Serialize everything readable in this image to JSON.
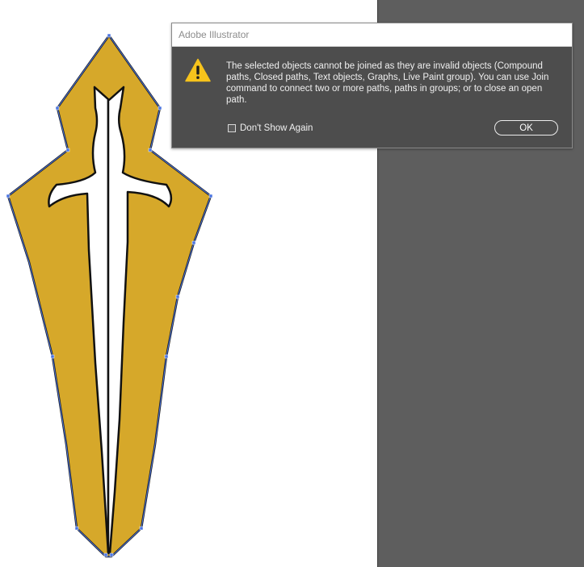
{
  "app": {
    "name": "Adobe Illustrator"
  },
  "colors": {
    "artwork_fill": "#d6a82a",
    "artwork_stroke": "#1a1a1a",
    "selection": "#4a74e0",
    "dialog_background": "#4d4d4d",
    "gutter": "#5e5e5e",
    "warning": "#f6c31c"
  },
  "dialog": {
    "title": "Adobe Illustrator",
    "icon": "warning-triangle-icon",
    "message": "The selected objects cannot be joined as they are invalid objects (Compound paths, Closed paths, Text objects, Graphs, Live Paint group). You can use Join command to connect two or more paths, paths in groups; or to close an open path.",
    "dont_show_again_label": "Don't Show Again",
    "dont_show_again_checked": false,
    "ok_label": "OK"
  }
}
